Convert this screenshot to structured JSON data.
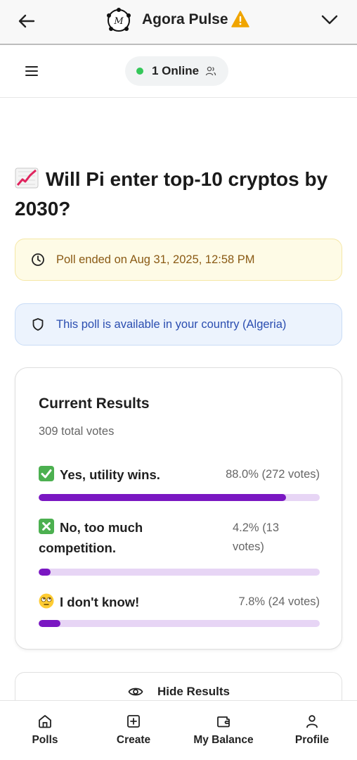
{
  "header": {
    "app_title": "Agora Pulse",
    "logo_letter": "M"
  },
  "subbar": {
    "online_text": "1 Online"
  },
  "poll": {
    "title_emoji": "chart-increasing-icon",
    "title": "Will Pi enter top-10 cryptos by 2030?",
    "ended_notice": "Poll ended on Aug 31, 2025, 12:58 PM",
    "country_notice": "This poll is available in your country (Algeria)"
  },
  "results": {
    "heading": "Current Results",
    "total_votes": "309 total votes",
    "options": [
      {
        "emoji": "check-mark-button-icon",
        "label": "Yes, utility wins.",
        "stat": "88.0% (272 votes)",
        "percent": 88.0
      },
      {
        "emoji": "cross-mark-button-icon",
        "label": "No, too much competition.",
        "stat": "4.2% (13 votes)",
        "percent": 4.2
      },
      {
        "emoji": "face-rolling-eyes-icon",
        "label": "I don't know!",
        "stat": "7.8% (24 votes)",
        "percent": 7.8
      }
    ],
    "hide_button_label": "Hide Results"
  },
  "nav": {
    "items": [
      {
        "label": "Polls",
        "icon": "home-icon"
      },
      {
        "label": "Create",
        "icon": "plus-square-icon"
      },
      {
        "label": "My Balance",
        "icon": "wallet-icon"
      },
      {
        "label": "Profile",
        "icon": "user-icon"
      }
    ]
  },
  "colors": {
    "accent": "#7a17c2",
    "bar_track": "#e7d5f5",
    "online": "#34c759",
    "warning": "#f0a500"
  }
}
